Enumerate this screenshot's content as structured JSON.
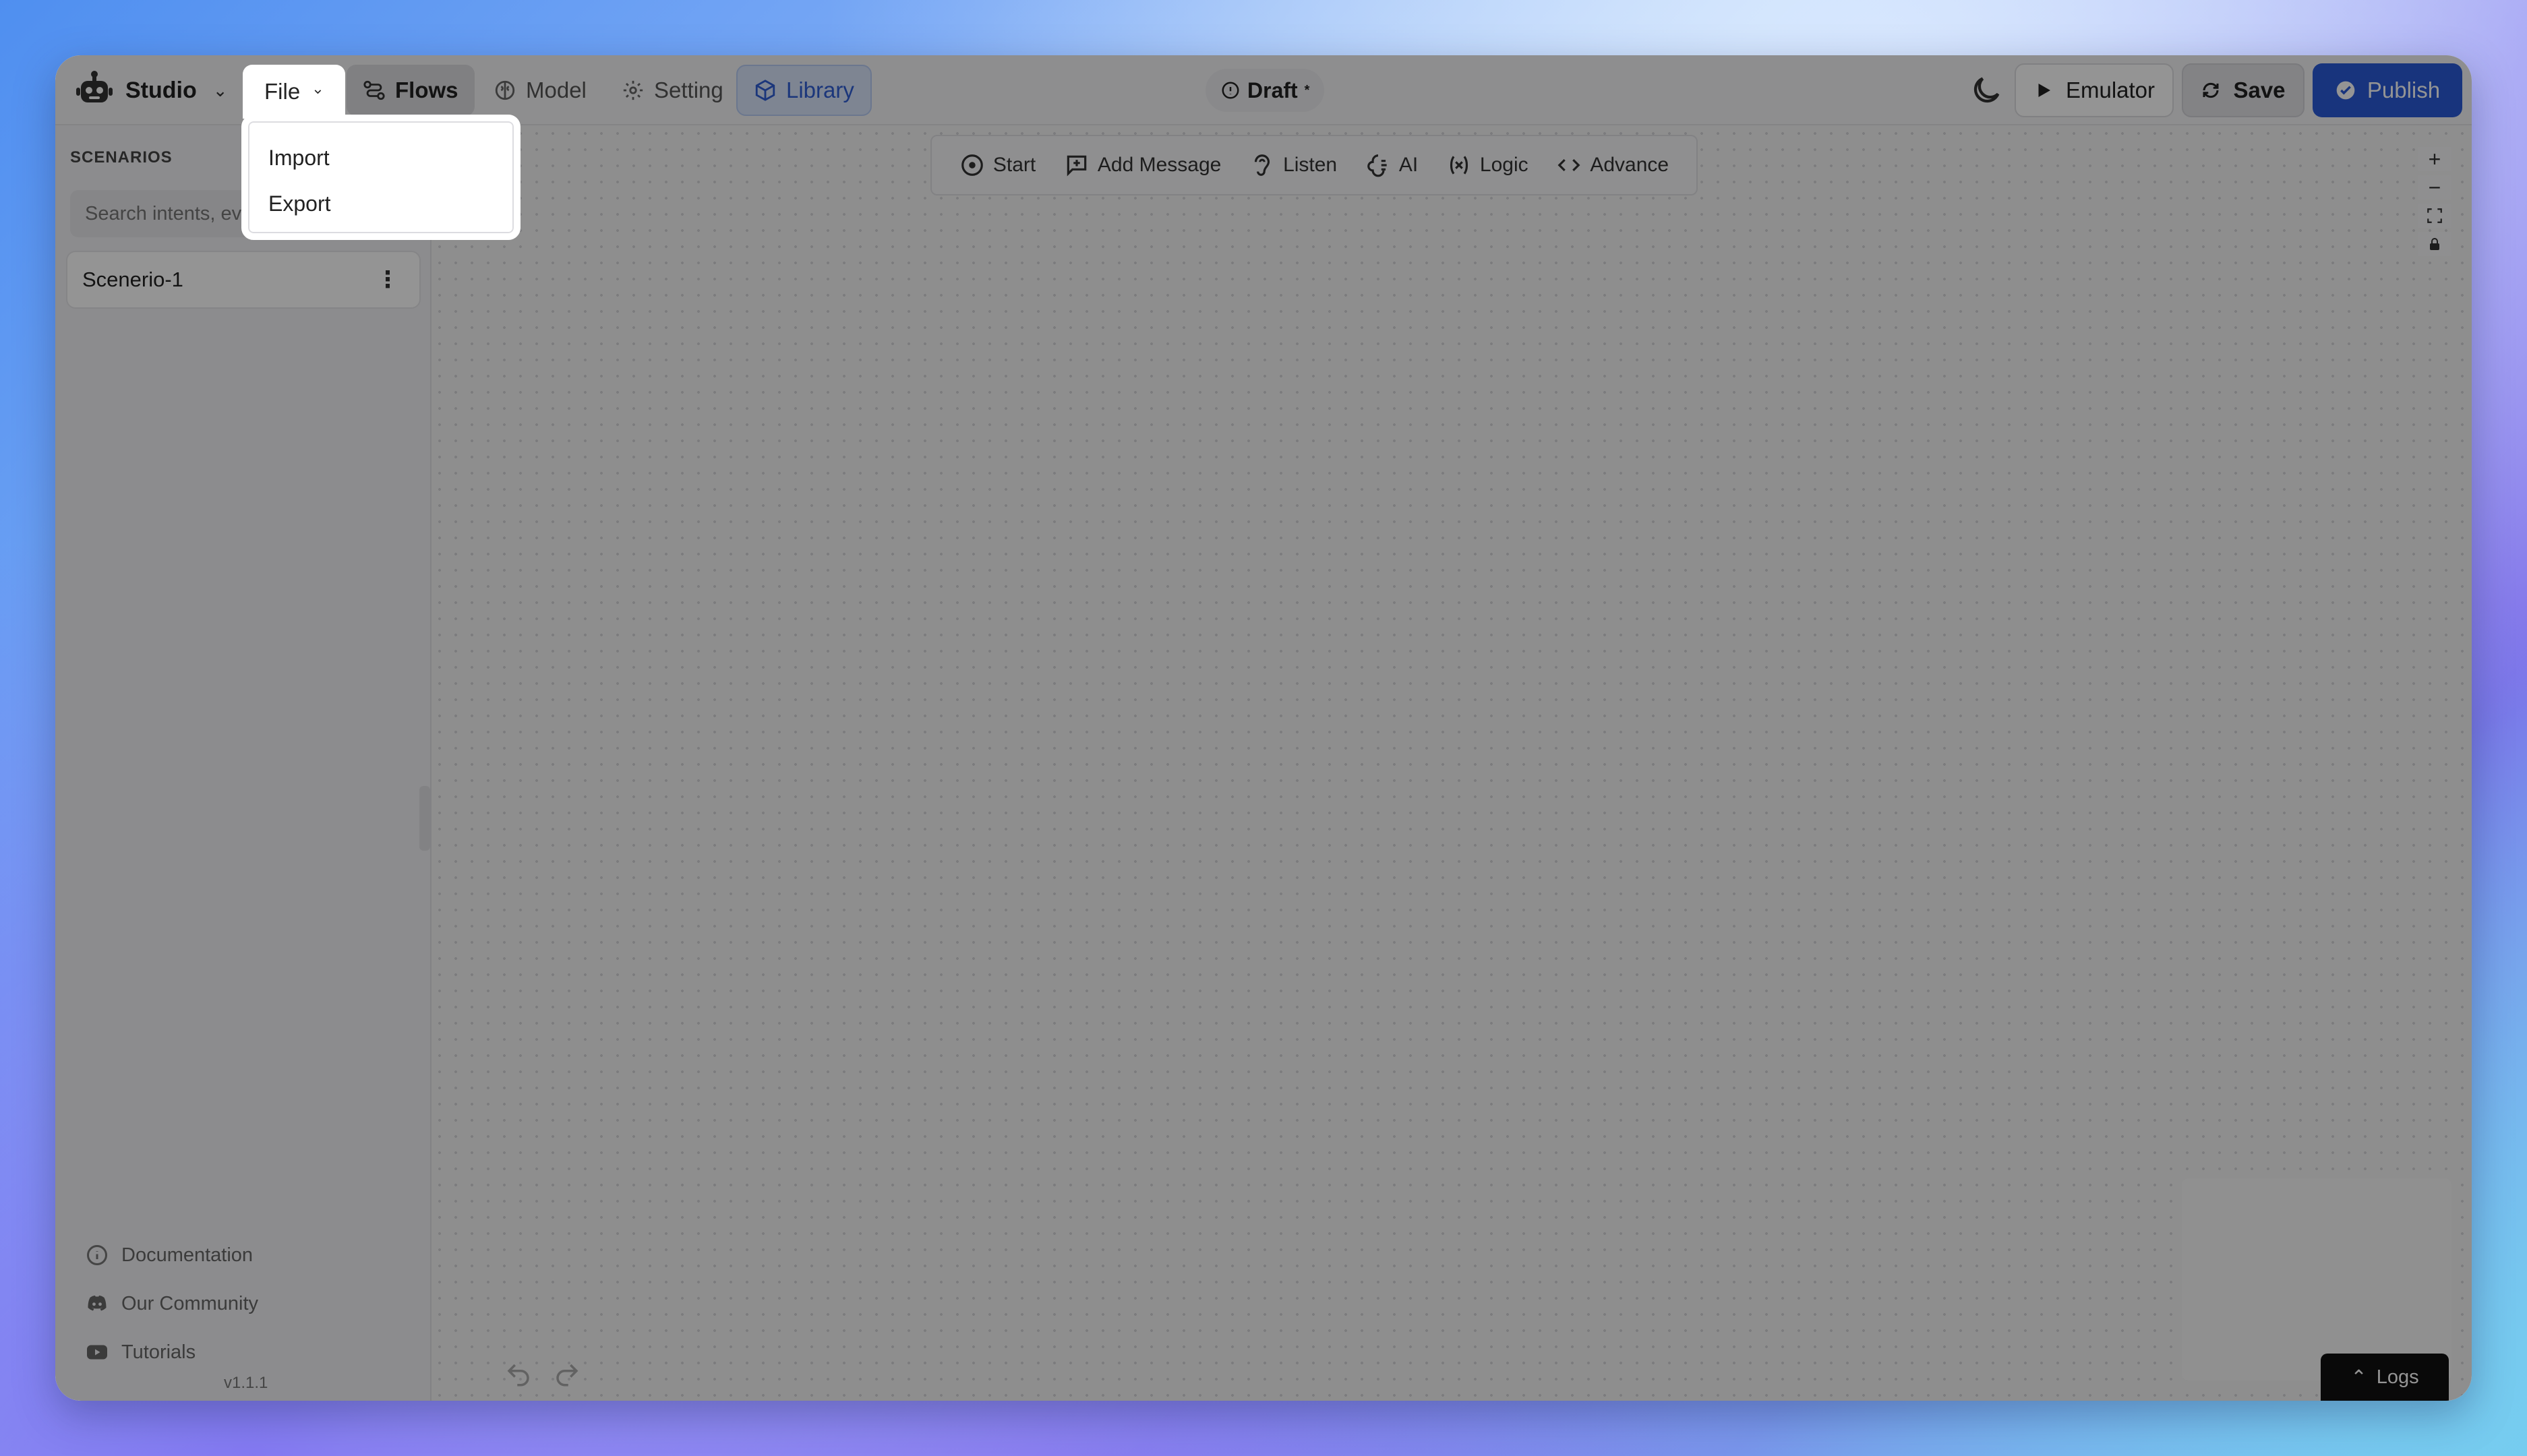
{
  "header": {
    "brand_name": "Studio",
    "nav": {
      "file": "File",
      "flows": "Flows",
      "model": "Model",
      "setting": "Setting",
      "library": "Library"
    },
    "status": "Draft",
    "status_marker": "*",
    "emulator_label": "Emulator",
    "save_label": "Save",
    "publish_label": "Publish"
  },
  "file_menu": {
    "items": [
      {
        "label": "Import"
      },
      {
        "label": "Export"
      }
    ]
  },
  "sidebar": {
    "section_title": "SCENARIOS",
    "search_placeholder": "Search intents, eve",
    "scenarios": [
      {
        "label": "Scenerio-1"
      }
    ],
    "links": [
      {
        "label": "Documentation",
        "icon": "info-icon"
      },
      {
        "label": "Our Community",
        "icon": "discord-icon"
      },
      {
        "label": "Tutorials",
        "icon": "youtube-icon"
      }
    ],
    "version": "v1.1.1"
  },
  "canvas": {
    "toolbar": [
      {
        "label": "Start",
        "icon": "play-circle-icon"
      },
      {
        "label": "Add Message",
        "icon": "message-plus-icon"
      },
      {
        "label": "Listen",
        "icon": "ear-icon"
      },
      {
        "label": "AI",
        "icon": "ai-icon"
      },
      {
        "label": "Logic",
        "icon": "variable-icon"
      },
      {
        "label": "Advance",
        "icon": "code-icon"
      }
    ],
    "zoom_controls": [
      "+",
      "−",
      "⛶",
      "🔒"
    ],
    "logs_label": "Logs"
  },
  "colors": {
    "publish": "#2a5bd7",
    "library_text": "#2f5ed4",
    "overlay": "rgba(0,0,0,0.42)"
  }
}
